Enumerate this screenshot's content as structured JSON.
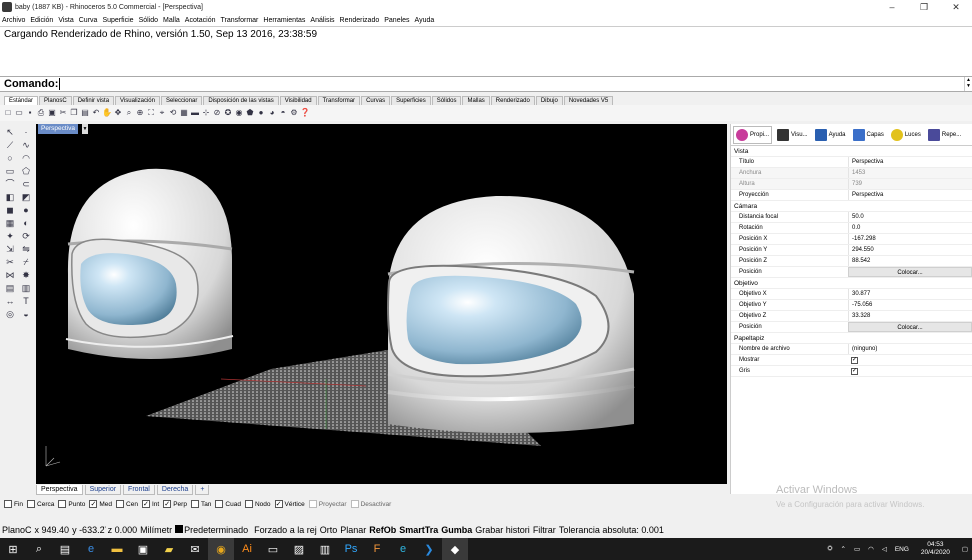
{
  "window": {
    "title": "baby (1887 KB) - Rhinoceros 5.0 Commercial - [Perspectiva]",
    "controls": [
      "–",
      "❐",
      "✕"
    ]
  },
  "menu": [
    "Archivo",
    "Edición",
    "Vista",
    "Curva",
    "Superficie",
    "Sólido",
    "Malla",
    "Acotación",
    "Transformar",
    "Herramientas",
    "Análisis",
    "Renderizado",
    "Paneles",
    "Ayuda"
  ],
  "history": {
    "text": "Cargando Renderizado de Rhino, versión 1.50, Sep 13 2016, 23:38:59"
  },
  "command": {
    "label": "Comando:",
    "value": ""
  },
  "toolbar_tabs": [
    "Estándar",
    "PlanosC",
    "Definir vista",
    "Visualización",
    "Seleccionar",
    "Disposición de las vistas",
    "Visibilidad",
    "Transformar",
    "Curvas",
    "Superficies",
    "Sólidos",
    "Mallas",
    "Renderizado",
    "Dibujo",
    "Novedades V5"
  ],
  "viewport": {
    "name": "Perspectiva"
  },
  "viewport_tabs": [
    "Perspectiva",
    "Superior",
    "Frontal",
    "Derecha",
    "+"
  ],
  "panel": {
    "tabs": [
      {
        "label": "Propi...",
        "icon": "properties-icon",
        "color": "#c83c9b"
      },
      {
        "label": "Visu...",
        "icon": "display-icon",
        "color": "#333333"
      },
      {
        "label": "Ayuda",
        "icon": "help-icon",
        "color": "#2a5fb0"
      },
      {
        "label": "Capas",
        "icon": "layers-icon",
        "color": "#3b6fc9"
      },
      {
        "label": "Luces",
        "icon": "lights-icon",
        "color": "#e2c21c"
      },
      {
        "label": "Repe...",
        "icon": "repeat-icon",
        "color": "#4a4a9a"
      }
    ],
    "sections": {
      "vista": "Vista",
      "camara": "Cámara",
      "objetivo": "Objetivo",
      "papeltapiz": "Papeltapiz"
    },
    "vista": {
      "titulo": {
        "k": "Título",
        "v": "Perspectiva"
      },
      "anchura": {
        "k": "Anchura",
        "v": "1453"
      },
      "altura": {
        "k": "Altura",
        "v": "739"
      },
      "proyeccion": {
        "k": "Proyección",
        "v": "Perspectiva"
      }
    },
    "camara": {
      "focal": {
        "k": "Distancia focal",
        "v": "50.0"
      },
      "rotacion": {
        "k": "Rotación",
        "v": "0.0"
      },
      "px": {
        "k": "Posición X",
        "v": "-167.298"
      },
      "py": {
        "k": "Posición Y",
        "v": "294.550"
      },
      "pz": {
        "k": "Posición Z",
        "v": "88.542"
      },
      "pos": {
        "k": "Posición",
        "v": "Colocar..."
      }
    },
    "objetivo": {
      "ox": {
        "k": "Objetivo X",
        "v": "30.877"
      },
      "oy": {
        "k": "Objetivo Y",
        "v": "-75.056"
      },
      "oz": {
        "k": "Objetivo Z",
        "v": "33.328"
      },
      "pos": {
        "k": "Posición",
        "v": "Colocar..."
      }
    },
    "papeltapiz": {
      "archivo": {
        "k": "Nombre de archivo",
        "v": "(ninguno)"
      },
      "mostrar": {
        "k": "Mostrar",
        "v": "✓"
      },
      "gris": {
        "k": "Gris",
        "v": "✓"
      }
    }
  },
  "snaps": [
    {
      "label": "Fin",
      "checked": false,
      "enabled": true
    },
    {
      "label": "Cerca",
      "checked": false,
      "enabled": true
    },
    {
      "label": "Punto",
      "checked": false,
      "enabled": true
    },
    {
      "label": "Med",
      "checked": true,
      "enabled": true
    },
    {
      "label": "Cen",
      "checked": false,
      "enabled": true
    },
    {
      "label": "Int",
      "checked": true,
      "enabled": true
    },
    {
      "label": "Perp",
      "checked": true,
      "enabled": true
    },
    {
      "label": "Tan",
      "checked": false,
      "enabled": true
    },
    {
      "label": "Cuad",
      "checked": false,
      "enabled": true
    },
    {
      "label": "Nodo",
      "checked": false,
      "enabled": true
    },
    {
      "label": "Vértice",
      "checked": true,
      "enabled": true
    },
    {
      "label": "Proyectar",
      "checked": false,
      "enabled": false
    },
    {
      "label": "Desactivar",
      "checked": false,
      "enabled": false
    }
  ],
  "status": {
    "cplane": "PlanoC",
    "x": "x 949.40",
    "y": "y -633.2̈",
    "z": "z 0.000",
    "units": "Milímetr",
    "layer": "Predeterminado",
    "forzado": "Forzado a la rej",
    "orto": "Orto",
    "planar": "Planar",
    "refobj": "RefOb",
    "smarttrack": "SmartTra",
    "gumball": "Gumba",
    "history": "Grabar histori",
    "filter": "Filtrar",
    "tolerance": "Tolerancia absoluta: 0.001"
  },
  "watermark": {
    "title": "Activar Windows",
    "subtitle": "Ve a Configuración para activar Windows."
  },
  "taskbar": {
    "time": "04:53",
    "date": "20/4/2020",
    "lang": "ENG",
    "apps": [
      "windows-logo",
      "search-icon",
      "task-view-icon",
      "edge-icon",
      "explorer-icon",
      "store-icon",
      "sticky-icon",
      "mail-icon",
      "chrome-icon",
      "illustrator-icon",
      "terminal-icon",
      "photos-icon",
      "film-icon",
      "photoshop-icon",
      "folder-app-icon",
      "edge-alt-icon",
      "vscode-icon",
      "rhino-icon"
    ]
  }
}
